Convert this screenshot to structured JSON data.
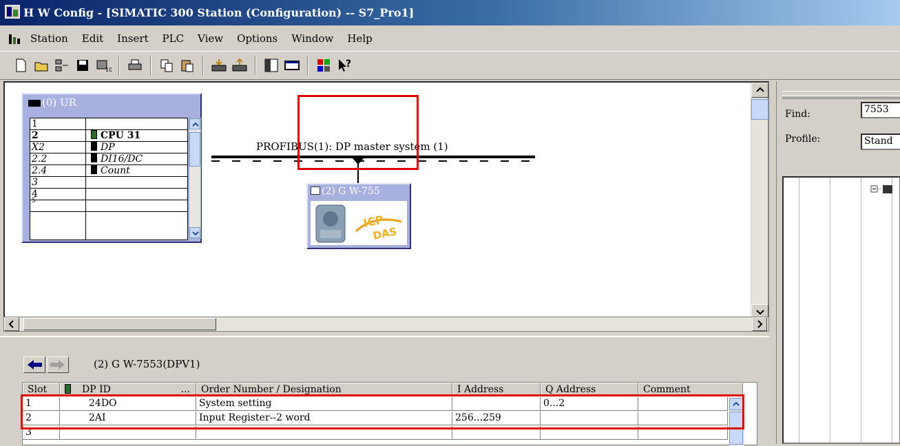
{
  "window": {
    "title": "H W Config - [SIMATIC 300 Station (Configuration) -- S7_Pro1]"
  },
  "menu": {
    "items": [
      "Station",
      "Edit",
      "Insert",
      "PLC",
      "View",
      "Options",
      "Window",
      "Help"
    ]
  },
  "toolbar": {
    "buttons": [
      "new",
      "open",
      "network",
      "save",
      "compile",
      "print",
      "copy",
      "paste",
      "download",
      "upload",
      "catalog",
      "window",
      "config",
      "help"
    ]
  },
  "rack": {
    "title": "(0) UR",
    "rows": [
      {
        "slot": "1",
        "module": ""
      },
      {
        "slot": "2",
        "module": "CPU 31"
      },
      {
        "slot": "X2",
        "module": "DP"
      },
      {
        "slot": "2.2",
        "module": "DI16/DC"
      },
      {
        "slot": "2.4",
        "module": "Count"
      },
      {
        "slot": "3",
        "module": ""
      },
      {
        "slot": "4",
        "module": ""
      },
      {
        "slot": "5",
        "module": ""
      }
    ]
  },
  "bus": {
    "label": "PROFIBUS(1): DP master system (1)"
  },
  "slave": {
    "title": "(2) G W-755",
    "logo_text_top": "ICP",
    "logo_text_bottom": "DAS"
  },
  "catalog": {
    "find_label": "Find:",
    "find_value": "7553",
    "profile_label": "Profile:",
    "profile_value": "Stand"
  },
  "detail": {
    "title": "(2)   G W-7553(DPV1)",
    "columns": {
      "slot": "Slot",
      "dpid": "DP ID",
      "dpid_more": "...",
      "order": "Order Number / Designation",
      "iaddr": "I Address",
      "qaddr": "Q Address",
      "comment": "Comment"
    },
    "rows": [
      {
        "slot": "1",
        "dpid": "24DO",
        "order": "System setting",
        "iaddr": "",
        "qaddr": "0...2",
        "comment": ""
      },
      {
        "slot": "2",
        "dpid": "2AI",
        "order": "Input Register--2 word",
        "iaddr": "256...259",
        "qaddr": "",
        "comment": ""
      },
      {
        "slot": "3",
        "dpid": "",
        "order": "",
        "iaddr": "",
        "qaddr": "",
        "comment": ""
      }
    ]
  },
  "colors": {
    "highlight": "#e00000",
    "titlebar": "#0a246a",
    "rack_bg": "#a8b0e0"
  }
}
